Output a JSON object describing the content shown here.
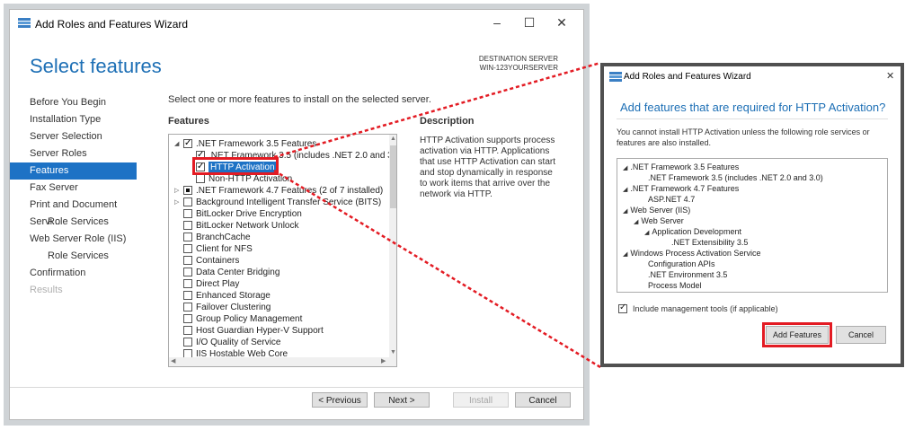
{
  "main_window": {
    "title": "Add Roles and Features Wizard",
    "controls": {
      "minimize": "–",
      "maximize": "☐",
      "close": "✕"
    },
    "heading": "Select features",
    "destination": {
      "label": "DESTINATION SERVER",
      "server": "WIN-123YOURSERVER"
    },
    "nav": [
      {
        "label": "Before You Begin"
      },
      {
        "label": "Installation Type"
      },
      {
        "label": "Server Selection"
      },
      {
        "label": "Server Roles"
      },
      {
        "label": "Features"
      },
      {
        "label": "Fax Server"
      },
      {
        "label": "Print and Document Servi..."
      },
      {
        "label": "Role Services"
      },
      {
        "label": "Web Server Role (IIS)"
      },
      {
        "label": "Role Services"
      },
      {
        "label": "Confirmation"
      },
      {
        "label": "Results"
      }
    ],
    "instruction": "Select one or more features to install on the selected server.",
    "features_header": "Features",
    "features": [
      {
        "label": ".NET Framework 3.5 Features",
        "state": "checked",
        "expander": "◢"
      },
      {
        "label": ".NET Framework 3.5 (includes .NET 2.0 and 3.0)",
        "state": "checked"
      },
      {
        "label": "HTTP Activation",
        "state": "checked",
        "highlighted": true
      },
      {
        "label": "Non-HTTP Activation",
        "state": "unchecked"
      },
      {
        "label": ".NET Framework 4.7 Features (2 of 7 installed)",
        "state": "partial",
        "expander": "▷"
      },
      {
        "label": "Background Intelligent Transfer Service (BITS)",
        "state": "unchecked",
        "expander": "▷"
      },
      {
        "label": "BitLocker Drive Encryption",
        "state": "unchecked"
      },
      {
        "label": "BitLocker Network Unlock",
        "state": "unchecked"
      },
      {
        "label": "BranchCache",
        "state": "unchecked"
      },
      {
        "label": "Client for NFS",
        "state": "unchecked"
      },
      {
        "label": "Containers",
        "state": "unchecked"
      },
      {
        "label": "Data Center Bridging",
        "state": "unchecked"
      },
      {
        "label": "Direct Play",
        "state": "unchecked"
      },
      {
        "label": "Enhanced Storage",
        "state": "unchecked"
      },
      {
        "label": "Failover Clustering",
        "state": "unchecked"
      },
      {
        "label": "Group Policy Management",
        "state": "unchecked"
      },
      {
        "label": "Host Guardian Hyper-V Support",
        "state": "unchecked"
      },
      {
        "label": "I/O Quality of Service",
        "state": "unchecked"
      },
      {
        "label": "IIS Hostable Web Core",
        "state": "unchecked"
      }
    ],
    "description_header": "Description",
    "description": "HTTP Activation supports process activation via HTTP. Applications that use HTTP Activation can start and stop dynamically in response to work items that arrive over the network via HTTP.",
    "buttons": {
      "previous": "< Previous",
      "next": "Next >",
      "install": "Install",
      "cancel": "Cancel"
    }
  },
  "dialog": {
    "title": "Add Roles and Features Wizard",
    "close": "✕",
    "heading": "Add features that are required for HTTP Activation?",
    "message": "You cannot install HTTP Activation unless the following role services or features are also installed.",
    "tree": [
      {
        "label": ".NET Framework 3.5 Features",
        "expander": "◢"
      },
      {
        "label": ".NET Framework 3.5 (includes .NET 2.0 and 3.0)"
      },
      {
        "label": ".NET Framework 4.7 Features",
        "expander": "◢"
      },
      {
        "label": "ASP.NET 4.7"
      },
      {
        "label": "Web Server (IIS)",
        "expander": "◢"
      },
      {
        "label": "Web Server",
        "expander": "◢"
      },
      {
        "label": "Application Development",
        "expander": "◢"
      },
      {
        "label": ".NET Extensibility 3.5"
      },
      {
        "label": "Windows Process Activation Service",
        "expander": "◢"
      },
      {
        "label": "Configuration APIs"
      },
      {
        "label": ".NET Environment 3.5"
      },
      {
        "label": "Process Model"
      }
    ],
    "include_tools": "Include management tools (if applicable)",
    "buttons": {
      "add": "Add Features",
      "cancel": "Cancel"
    }
  },
  "colors": {
    "accent": "#1d6fb5",
    "selection": "#1d72c5",
    "highlight": "#e31b23"
  }
}
